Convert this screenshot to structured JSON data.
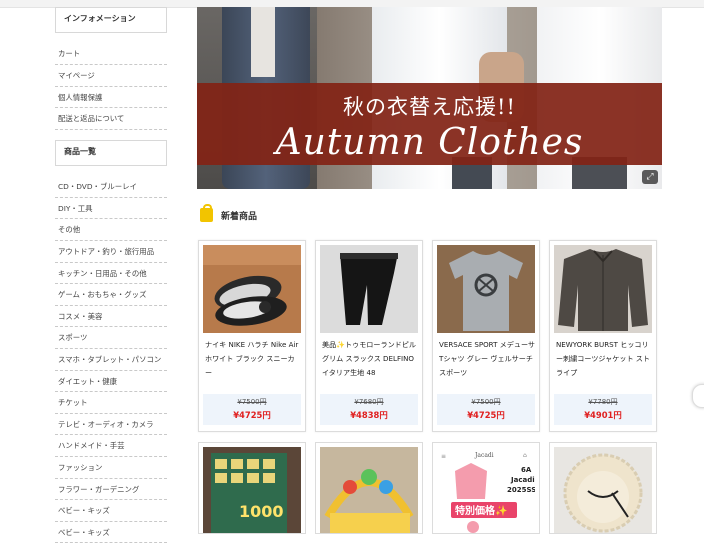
{
  "sidebar": {
    "info_title": "インフォメーション",
    "info_links": [
      "カート",
      "マイページ",
      "個人情報保護",
      "配送と返品について"
    ],
    "category_title": "商品一覧",
    "categories": [
      "CD・DVD・ブルーレイ",
      "DIY・工具",
      "その他",
      "アウトドア・釣り・旅行用品",
      "キッチン・日用品・その他",
      "ゲーム・おもちゃ・グッズ",
      "コスメ・美容",
      "スポーツ",
      "スマホ・タブレット・パソコン",
      "ダイエット・健康",
      "チケット",
      "テレビ・オーディオ・カメラ",
      "ハンドメイド・手芸",
      "ファッション",
      "フラワー・ガーデニング",
      "ベビー・キッズ",
      "ベビー・キッズ"
    ]
  },
  "hero": {
    "title_jp": "秋の衣替え応援!!",
    "title_en": "Autumn Clothes",
    "expand_icon": "expand-icon"
  },
  "section": {
    "title": "新着商品",
    "icon": "shopping-bag-icon",
    "icon_color": "#f2c400"
  },
  "products": [
    {
      "name": "ナイキ NIKE ハラチ Nike Air ホワイト ブラック スニーカー",
      "old_price": "¥7500円",
      "price": "¥4725円"
    },
    {
      "name": "美品✨トゥモローランドピルグリム スラックス DELFINO イタリア生地 48",
      "old_price": "¥7680円",
      "price": "¥4838円"
    },
    {
      "name": "VERSACE SPORT メデューサ Tシャツ グレー ヴェルサーチスポーツ",
      "old_price": "¥7500円",
      "price": "¥4725円"
    },
    {
      "name": "NEWYORK BURST ヒッコリー刺繍コーツジャケット ストライプ",
      "old_price": "¥7780円",
      "price": "¥4901円"
    }
  ],
  "bottom_row": {
    "card3_brand": "Jacadi",
    "card3_size": "6A",
    "card3_line2": "Jacadi",
    "card3_season": "2025SS",
    "card3_badge": "特別価格✨",
    "card1_box_text": "1000"
  },
  "colors": {
    "price_red": "#e02020",
    "banner_red": "#822416",
    "price_bg": "#eef4fb"
  }
}
